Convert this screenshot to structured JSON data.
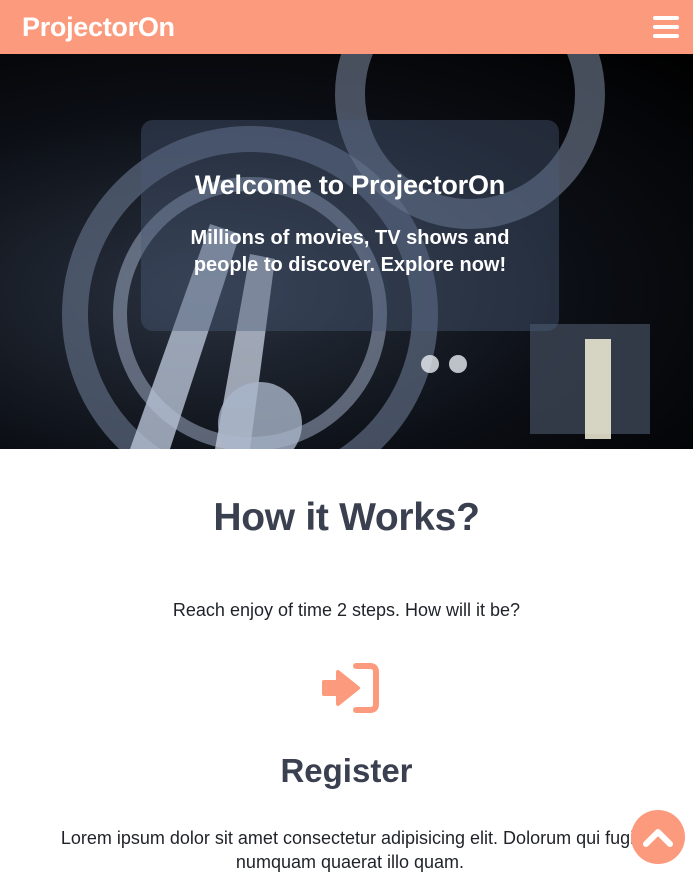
{
  "navbar": {
    "brand": "ProjectorOn",
    "menu_icon": "hamburger-icon"
  },
  "hero": {
    "title": "Welcome to ProjectorOn",
    "subtitle": "Millions of movies, TV shows and people to discover. Explore now!"
  },
  "how_it_works": {
    "title": "How it Works?",
    "subtitle": "Reach enjoy of time 2 steps. How will it be?"
  },
  "step": {
    "icon": "sign-in-icon",
    "title": "Register",
    "text": "Lorem ipsum dolor sit amet consectetur adipisicing elit. Dolorum qui fugit numquam quaerat illo quam."
  },
  "scroll_top": {
    "icon": "chevron-up-icon"
  },
  "colors": {
    "accent": "#fc9a7e",
    "heading": "#3b4050",
    "text": "#1f2228"
  }
}
